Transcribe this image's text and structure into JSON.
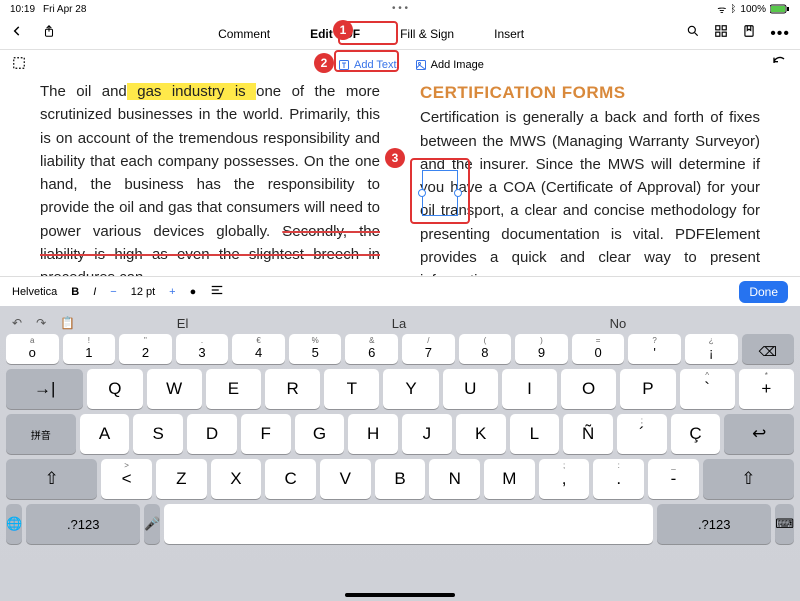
{
  "status": {
    "time": "10:19",
    "date": "Fri Apr 28",
    "battery": "100%"
  },
  "tabs": {
    "comment": "Comment",
    "edit_pdf": "Edit PDF",
    "fill_sign": "Fill & Sign",
    "insert": "Insert"
  },
  "sub": {
    "add_text": "Add Text",
    "add_image": "Add Image"
  },
  "doc": {
    "left_frag1": "The oil and",
    "left_hl": " gas industry is ",
    "left_frag2": "one of the more scrutinized businesses in the world. Primarily, this is on account of the tremendous responsibility and liability that each company possesses. On the one hand, the business has the responsibility to provide the oil and gas that consumers will need to power various devices globally. ",
    "left_strike": "Secondly, the liability is high as even the slightest breech in procedures can",
    "right_title": "CERTIFICATION FORMS",
    "right_body": "Certification is generally a back and forth of fixes between the MWS (Managing Warranty Surveyor) and the insurer. Since the MWS will determine if you have a COA (Certificate of Approval) for your oil transport, a clear and concise methodology for presenting documentation is vital. PDFElement provides a quick and clear way to present information"
  },
  "format": {
    "font": "Helvetica",
    "size": "12 pt",
    "done": "Done"
  },
  "suggest": {
    "w1": "El",
    "w2": "La",
    "w3": "No"
  },
  "callouts": {
    "c1": "1",
    "c2": "2",
    "c3": "3"
  },
  "kb": {
    "row1_sub": [
      "a",
      "!",
      "\"",
      ".",
      "€",
      "%",
      "&",
      "/",
      "(",
      ")",
      "=",
      "?",
      "¿"
    ],
    "row1_main": [
      "o",
      "1",
      "2",
      "3",
      "4",
      "5",
      "6",
      "7",
      "8",
      "9",
      "0",
      "'",
      "¡"
    ],
    "row2": [
      "Q",
      "W",
      "E",
      "R",
      "T",
      "Y",
      "U",
      "I",
      "O",
      "P"
    ],
    "row2_sub_left": "\"",
    "row2_sub_right_hat": "^",
    "row2_sub_right_star": "*",
    "row3_left": "拼音",
    "row3": [
      "A",
      "S",
      "D",
      "F",
      "G",
      "H",
      "J",
      "K",
      "L",
      "Ñ"
    ],
    "row3_sub": ";",
    "row3_end": "Ç",
    "row4": [
      "Z",
      "X",
      "C",
      "V",
      "B",
      "N",
      "M"
    ],
    "row4_subs": [
      ">",
      "<",
      "",
      "",
      "",
      "",
      "",
      ",",
      ".",
      "_"
    ],
    "row4_keys_right": [
      ",",
      ".",
      "-"
    ],
    "row5_alt": ".?123",
    "row5_mic": "🎤"
  }
}
